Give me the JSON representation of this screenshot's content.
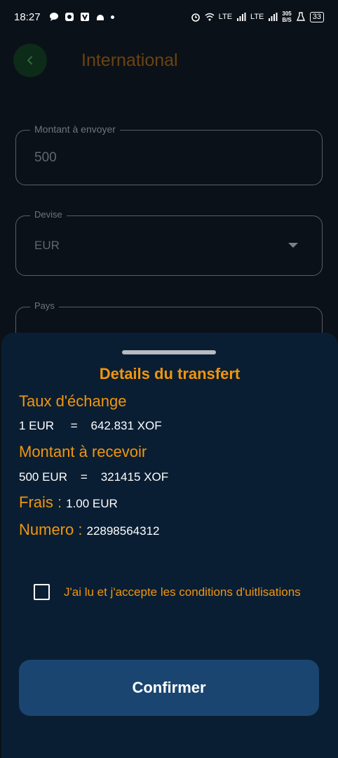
{
  "status_bar": {
    "time": "18:27",
    "network_1": "LTE",
    "network_2": "LTE",
    "speed_value": "305",
    "speed_unit": "B/S",
    "battery": "33"
  },
  "app_bar": {
    "title": "International",
    "back_icon": "chevron-left-icon"
  },
  "form": {
    "amount": {
      "label": "Montant à envoyer",
      "value": "500"
    },
    "currency": {
      "label": "Devise",
      "value": "EUR"
    },
    "country": {
      "label": "Pays",
      "value": ""
    }
  },
  "sheet": {
    "title": "Details du transfert",
    "exchange_rate": {
      "label": "Taux d'échange",
      "value": "1 EUR     =    642.831 XOF"
    },
    "amount_to_receive": {
      "label": "Montant à recevoir",
      "value": "500 EUR    =    321415 XOF"
    },
    "fees": {
      "label": "Frais :",
      "value": "1.00 EUR"
    },
    "number": {
      "label": "Numero :",
      "value": "22898564312"
    },
    "terms_label": "J'ai lu et j'accepte les conditions d'uitlisations",
    "terms_checked": false,
    "confirm_label": "Confirmer"
  },
  "colors": {
    "accent": "#f0960c",
    "sheet_bg": "#0a1e33",
    "button_bg": "#1a4570",
    "page_bg": "#0b1118"
  }
}
